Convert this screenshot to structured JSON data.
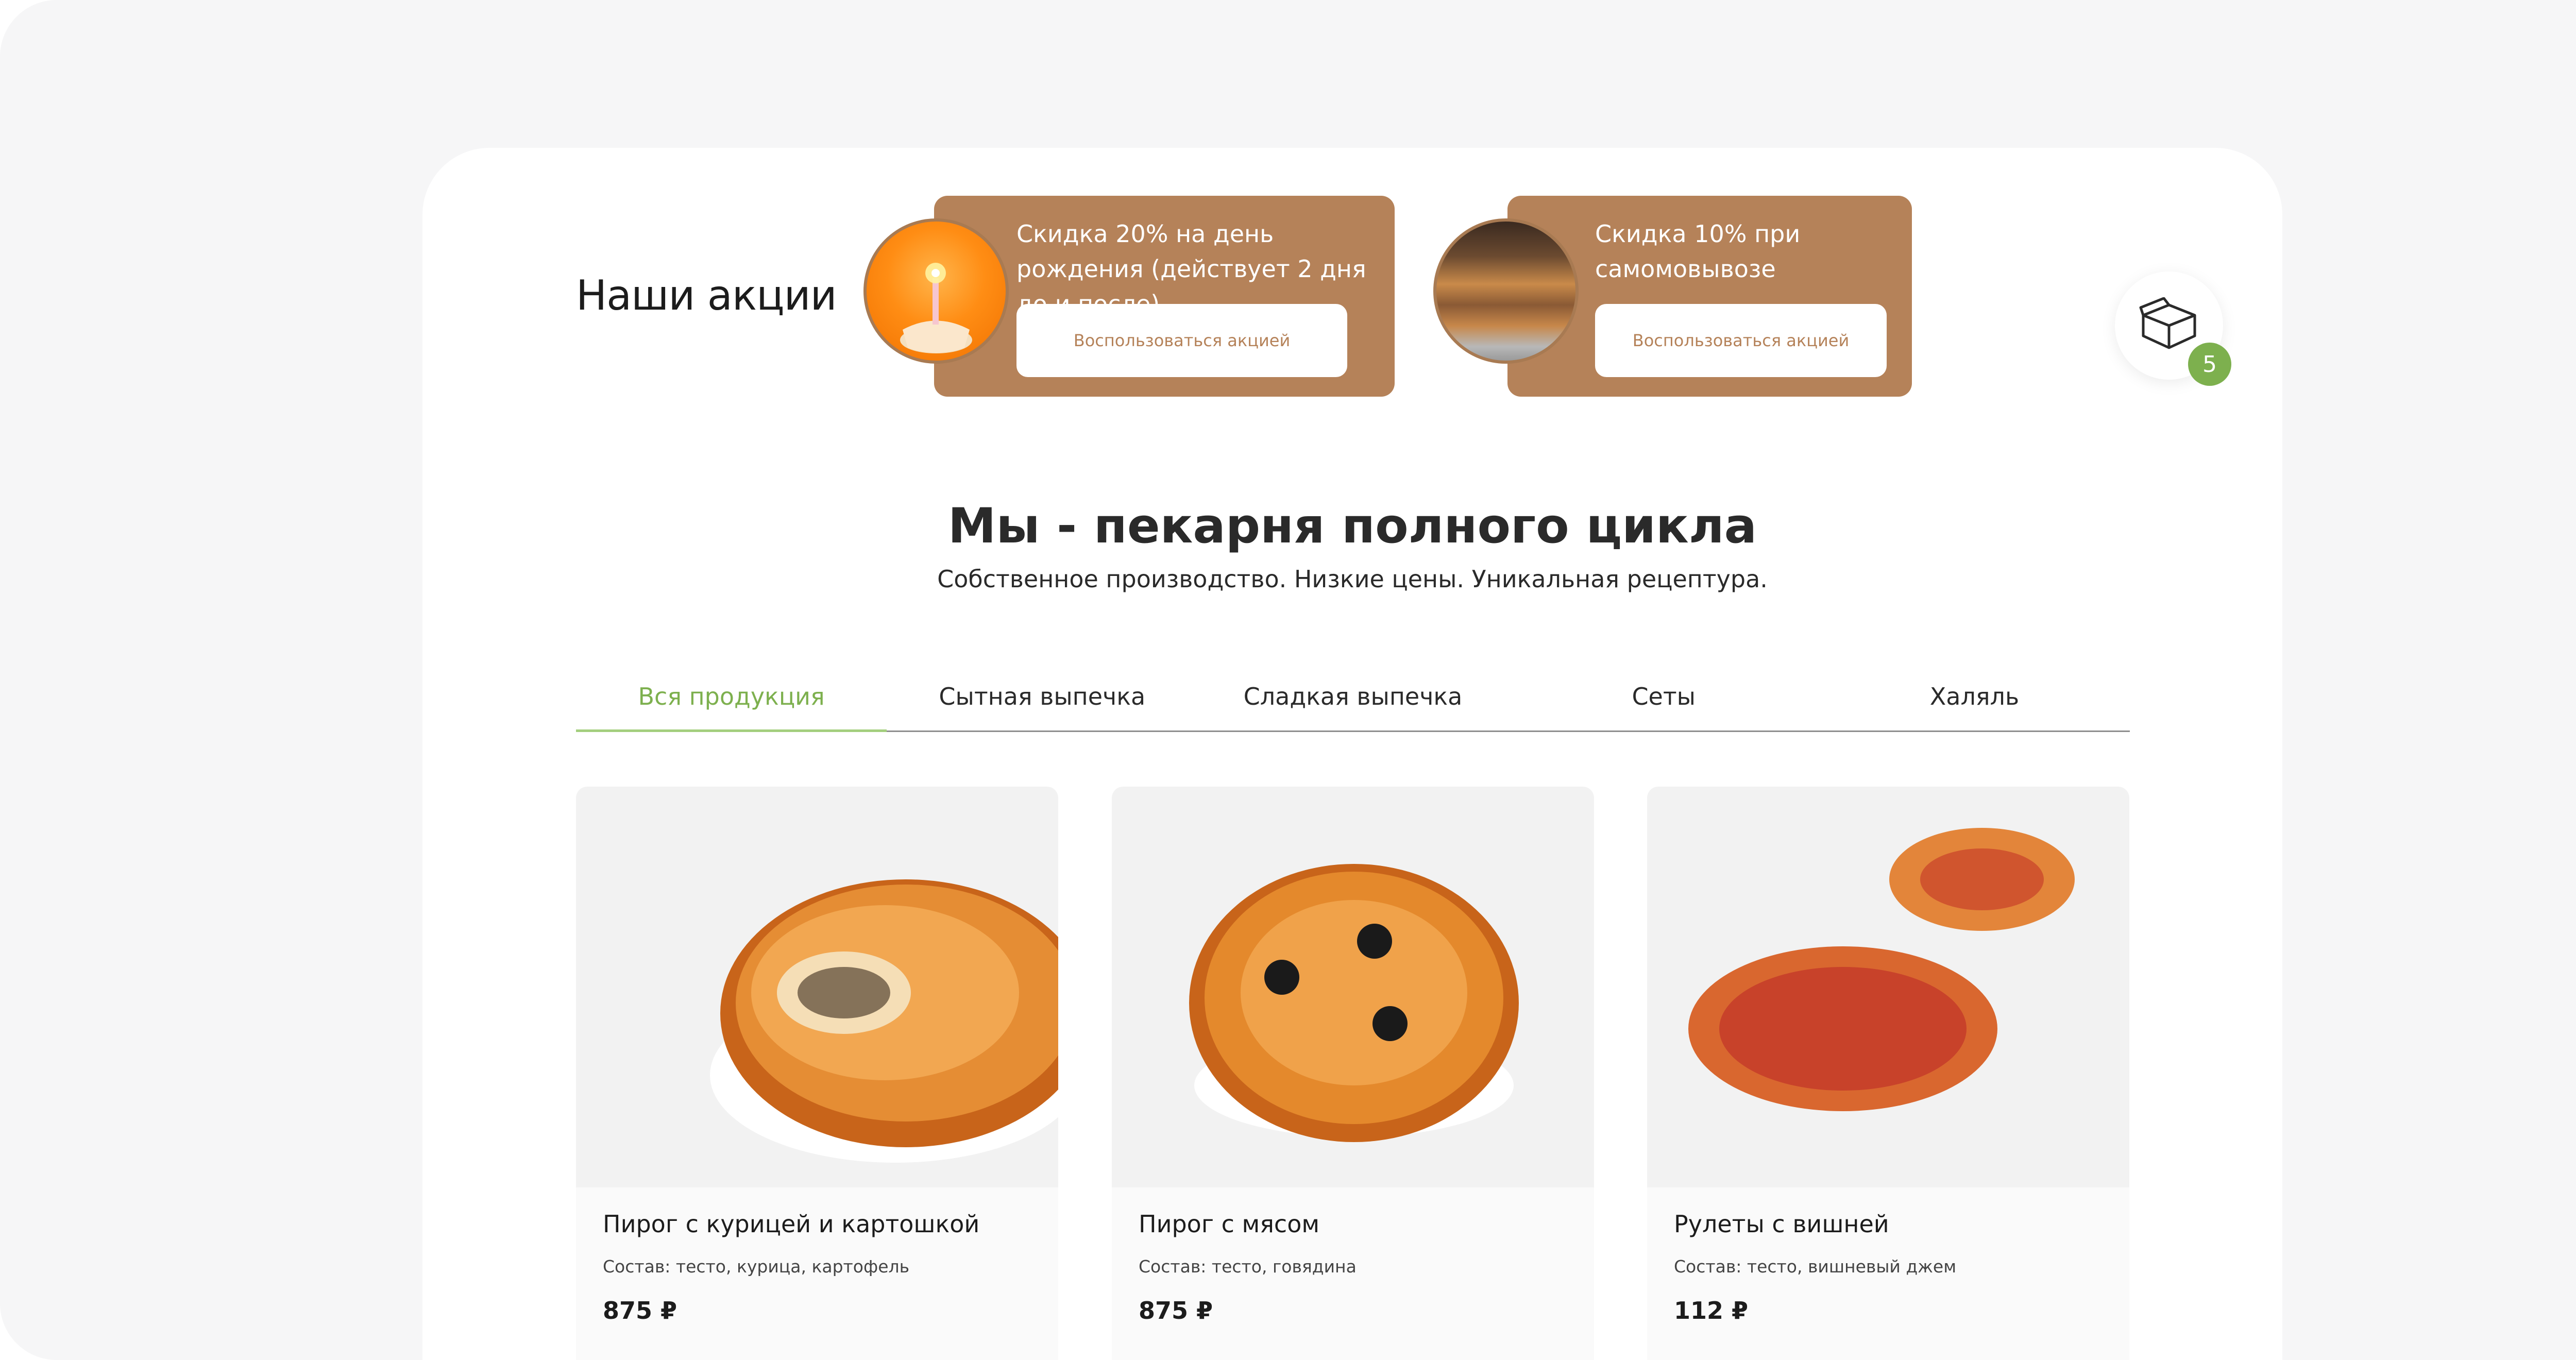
{
  "promotions": {
    "title": "Наши акции",
    "cards": [
      {
        "text": "Скидка 20% на день рождения (действует 2 дня до и после)",
        "button": "Воспользоваться акцией",
        "image": "birthday-cupcake"
      },
      {
        "text": "Скидка 10% при самомовывозе",
        "button": "Воспользоваться акцией",
        "image": "bakery-showcase"
      }
    ]
  },
  "cart": {
    "icon": "box-icon",
    "count": "5"
  },
  "hero": {
    "title": "Мы - пекарня полного цикла",
    "subtitle": "Собственное производство. Низкие цены. Уникальная рецептура."
  },
  "tabs": [
    {
      "label": "Вся продукция",
      "active": true
    },
    {
      "label": "Сытная выпечка",
      "active": false
    },
    {
      "label": "Сладкая выпечка",
      "active": false
    },
    {
      "label": "Сеты",
      "active": false
    },
    {
      "label": "Халяль",
      "active": false
    }
  ],
  "products": [
    {
      "name": "Пирог с курицей и картошкой",
      "composition": "Состав: тесто, курица, картофель",
      "price": "875 ₽"
    },
    {
      "name": "Пирог с мясом",
      "composition": "Состав: тесто, говядина",
      "price": "875 ₽"
    },
    {
      "name": "Рулеты с вишней",
      "composition": "Состав: тесто, вишневый джем",
      "price": "112 ₽"
    }
  ],
  "colors": {
    "accent": "#7db04e",
    "promo": "#b58259"
  }
}
